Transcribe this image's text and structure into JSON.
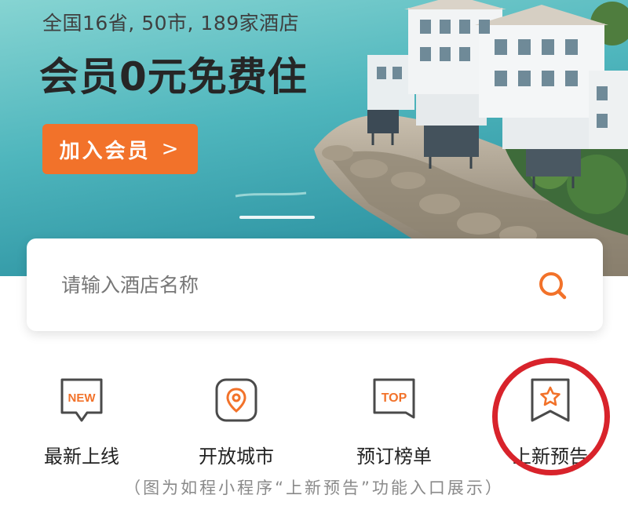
{
  "banner": {
    "subtitle": "全国16省, 50市, 189家酒店",
    "title": "会员0元免费住",
    "join_button": "加入会员",
    "join_chevron": ">"
  },
  "search": {
    "placeholder": "请输入酒店名称"
  },
  "entries": [
    {
      "label": "最新上线",
      "badge": "NEW",
      "icon": "new-badge-icon"
    },
    {
      "label": "开放城市",
      "icon": "location-pin-icon"
    },
    {
      "label": "预订榜单",
      "badge": "TOP",
      "icon": "top-badge-icon"
    },
    {
      "label": "上新预告",
      "icon": "star-bookmark-icon"
    }
  ],
  "caption": "（图为如程小程序“上新预告”功能入口展示）",
  "colors": {
    "accent": "#f2722a",
    "highlight_ring": "#d8232b",
    "text": "#222222",
    "caption": "#8a8a8a"
  }
}
